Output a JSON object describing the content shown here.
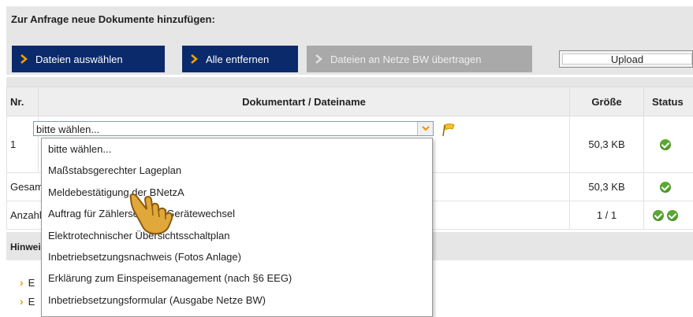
{
  "panel": {
    "title": "Zur Anfrage neue Dokumente hinzufügen:"
  },
  "toolbar": {
    "select_files": "Dateien auswählen",
    "remove_all": "Alle entfernen",
    "transfer": "Dateien an Netze BW übertragen",
    "upload": "Upload"
  },
  "table": {
    "headers": {
      "nr": "Nr.",
      "doc": "Dokumentart / Dateiname",
      "size": "Größe",
      "status": "Status"
    },
    "row1": {
      "nr": "1",
      "select_value": "bitte wählen...",
      "size": "50,3 KB"
    },
    "total_row": {
      "label": "Gesamt",
      "size": "50,3 KB"
    },
    "count_row": {
      "label": "Anzahl",
      "size": "1 / 1"
    }
  },
  "dropdown": {
    "items": [
      "bitte wählen...",
      "Maßstabsgerechter Lageplan",
      "Meldebestätigung der BNetzA",
      "Auftrag für Zählersetzung/Gerätewechsel",
      "Elektrotechnischer Übersichtsschaltplan",
      "Inbetriebsetzungsnachweis (Fotos Anlage)",
      "Erklärung zum Einspeisemanagement (nach §6 EEG)",
      "Inbetriebsetzungsformular (Ausgabe Netze BW)"
    ]
  },
  "hints": {
    "title": "Hinweise",
    "item1": "E",
    "item2": "E"
  },
  "colors": {
    "primary_button": "#0b2a6b",
    "disabled_button": "#a9a9a9",
    "accent": "#f0a400",
    "ok": "#5aa832"
  }
}
